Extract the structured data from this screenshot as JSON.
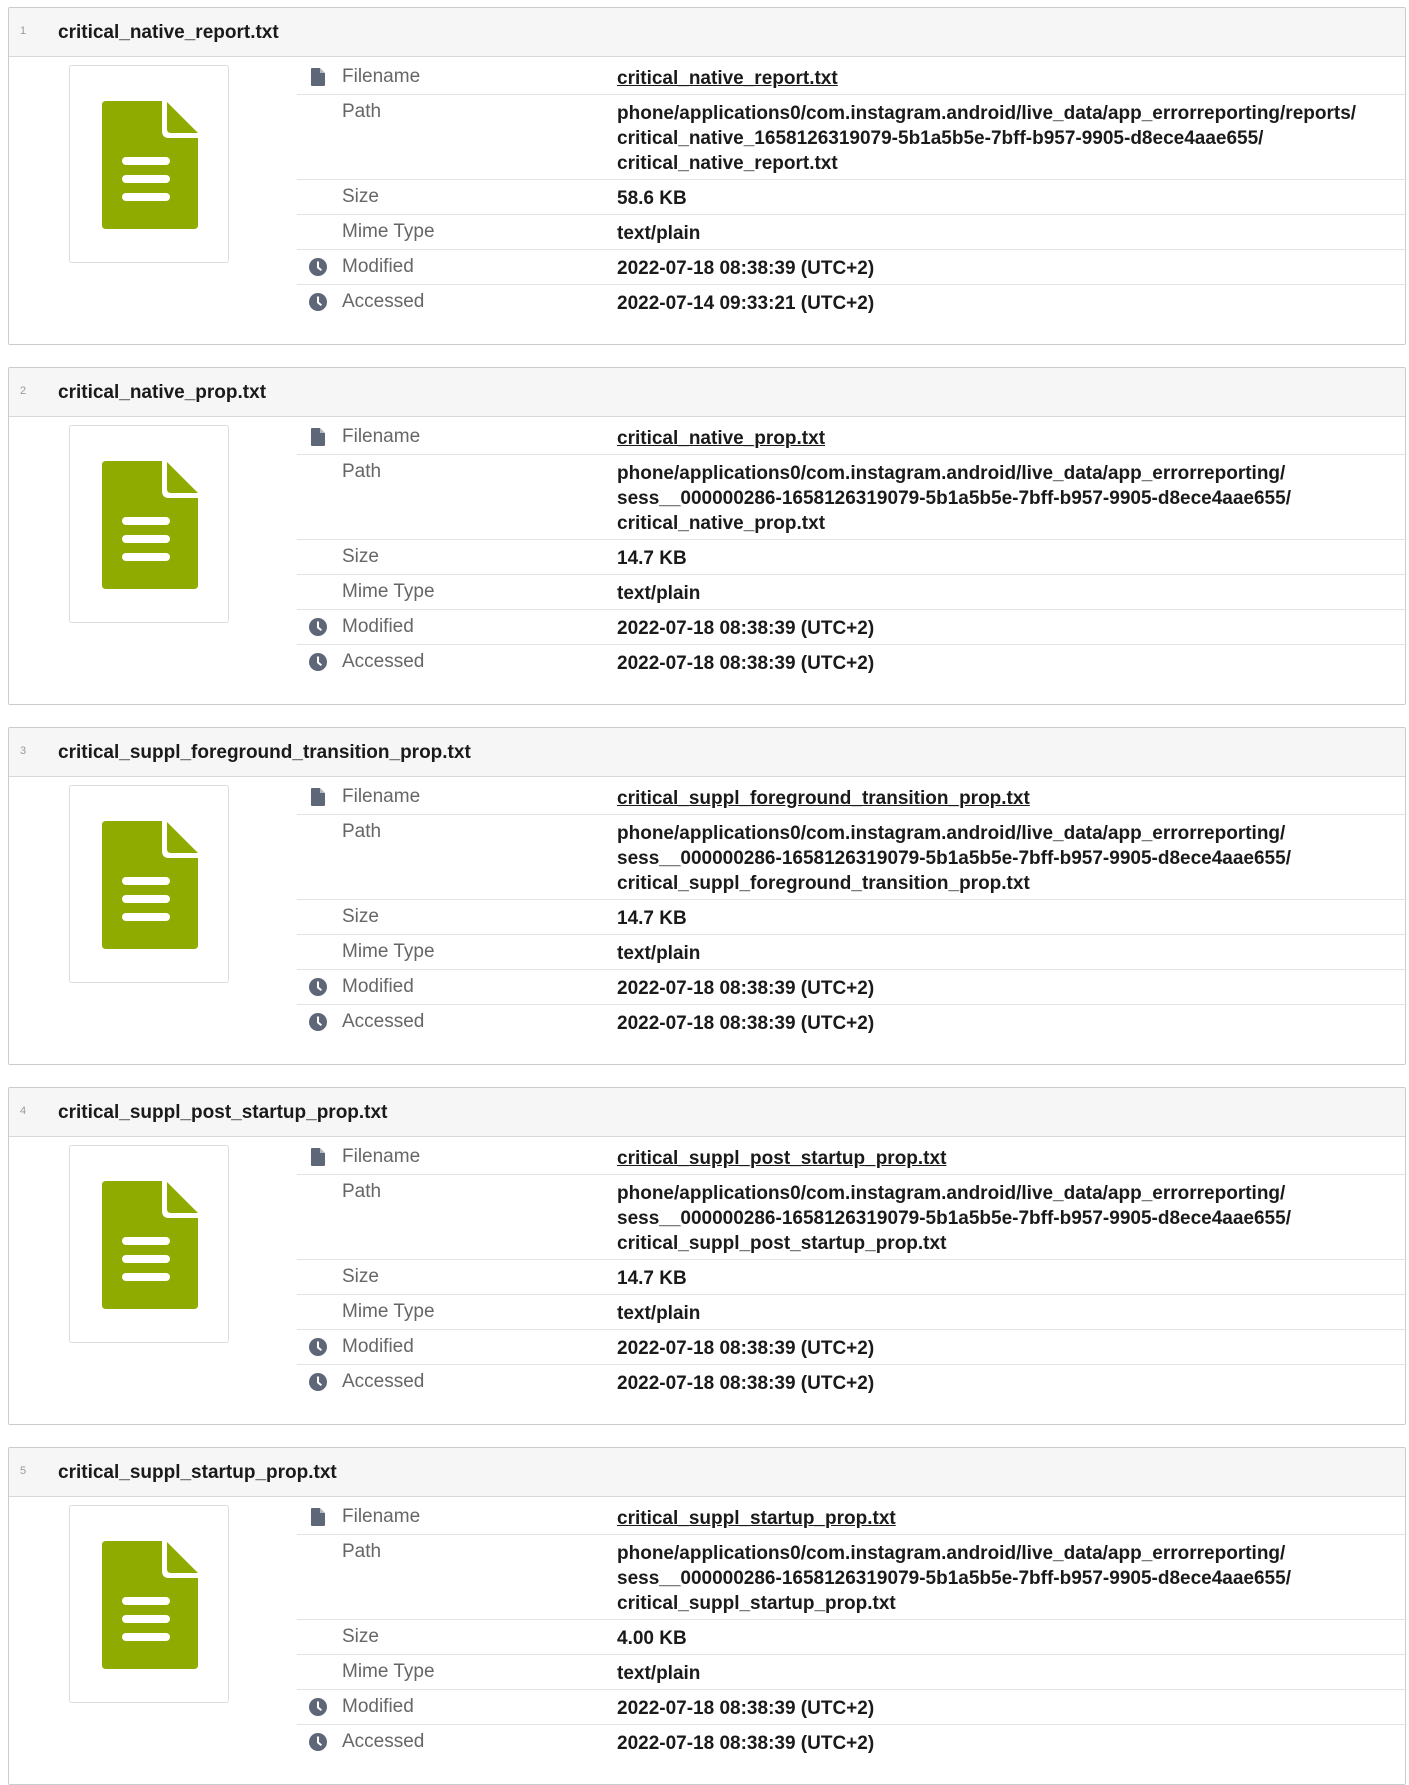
{
  "labels": {
    "filename": "Filename",
    "path": "Path",
    "size": "Size",
    "mime": "Mime Type",
    "modified": "Modified",
    "accessed": "Accessed"
  },
  "colors": {
    "file_icon": "#8fab00",
    "clock_icon": "#5d6777"
  },
  "icons": {
    "thumbnail": "text-file-icon",
    "filename": "file-icon",
    "time": "clock-icon"
  },
  "files": [
    {
      "index": "1",
      "title": "critical_native_report.txt",
      "filename": "critical_native_report.txt",
      "path": [
        "phone/applications0/com.instagram.android/live_data/app_errorreporting/reports/",
        "critical_native_1658126319079-5b1a5b5e-7bff-b957-9905-d8ece4aae655/",
        "critical_native_report.txt"
      ],
      "size": "58.6 KB",
      "mime": "text/plain",
      "modified": "2022-07-18 08:38:39 (UTC+2)",
      "accessed": "2022-07-14 09:33:21 (UTC+2)"
    },
    {
      "index": "2",
      "title": "critical_native_prop.txt",
      "filename": "critical_native_prop.txt",
      "path": [
        "phone/applications0/com.instagram.android/live_data/app_errorreporting/",
        "sess__000000286-1658126319079-5b1a5b5e-7bff-b957-9905-d8ece4aae655/",
        "critical_native_prop.txt"
      ],
      "size": "14.7 KB",
      "mime": "text/plain",
      "modified": "2022-07-18 08:38:39 (UTC+2)",
      "accessed": "2022-07-18 08:38:39 (UTC+2)"
    },
    {
      "index": "3",
      "title": "critical_suppl_foreground_transition_prop.txt",
      "filename": "critical_suppl_foreground_transition_prop.txt",
      "path": [
        "phone/applications0/com.instagram.android/live_data/app_errorreporting/",
        "sess__000000286-1658126319079-5b1a5b5e-7bff-b957-9905-d8ece4aae655/",
        "critical_suppl_foreground_transition_prop.txt"
      ],
      "size": "14.7 KB",
      "mime": "text/plain",
      "modified": "2022-07-18 08:38:39 (UTC+2)",
      "accessed": "2022-07-18 08:38:39 (UTC+2)"
    },
    {
      "index": "4",
      "title": "critical_suppl_post_startup_prop.txt",
      "filename": "critical_suppl_post_startup_prop.txt",
      "path": [
        "phone/applications0/com.instagram.android/live_data/app_errorreporting/",
        "sess__000000286-1658126319079-5b1a5b5e-7bff-b957-9905-d8ece4aae655/",
        "critical_suppl_post_startup_prop.txt"
      ],
      "size": "14.7 KB",
      "mime": "text/plain",
      "modified": "2022-07-18 08:38:39 (UTC+2)",
      "accessed": "2022-07-18 08:38:39 (UTC+2)"
    },
    {
      "index": "5",
      "title": "critical_suppl_startup_prop.txt",
      "filename": "critical_suppl_startup_prop.txt",
      "path": [
        "phone/applications0/com.instagram.android/live_data/app_errorreporting/",
        "sess__000000286-1658126319079-5b1a5b5e-7bff-b957-9905-d8ece4aae655/",
        "critical_suppl_startup_prop.txt"
      ],
      "size": "4.00 KB",
      "mime": "text/plain",
      "modified": "2022-07-18 08:38:39 (UTC+2)",
      "accessed": "2022-07-18 08:38:39 (UTC+2)"
    }
  ]
}
